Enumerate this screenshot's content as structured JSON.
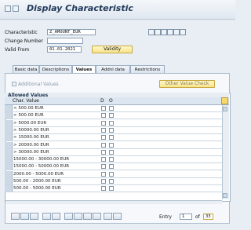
{
  "window": {
    "title": "Display Characteristic"
  },
  "header": {
    "characteristic_label": "Characteristic",
    "characteristic_value": "Z_AMOUNT_EUR",
    "change_number_label": "Change Number",
    "change_number_value": "",
    "valid_from_label": "Valid From",
    "valid_from_value": "01.01.2021",
    "validity_button": "Validity"
  },
  "tabs": [
    "Basic data",
    "Descriptions",
    "Values",
    "Addnl data",
    "Restrictions"
  ],
  "active_tab": "Values",
  "values_tab": {
    "additional_values_label": "Additional Values",
    "other_value_check_button": "Other Value Check",
    "allowed_values_title": "Allowed Values",
    "columns": [
      "Char. Value",
      "D",
      "O"
    ],
    "rows": [
      "< 500.00 EUR",
      "> 500.00 EUR",
      "> 5000.00 EUR",
      "> 50000.00 EUR",
      "> 15000.00 EUR",
      "> 20000.00 EUR",
      "> 30000.00 EUR",
      "15000.00 - 30000.00 EUR",
      "15000.00 - 50000.00 EUR",
      "2000.00 - 5000.00 EUR",
      "500.00 - 2000.00 EUR",
      "500.00 - 5000.00 EUR"
    ]
  },
  "footer": {
    "entry_label": "Entry",
    "entry_value": "1",
    "of_label": "of",
    "total": "33"
  }
}
